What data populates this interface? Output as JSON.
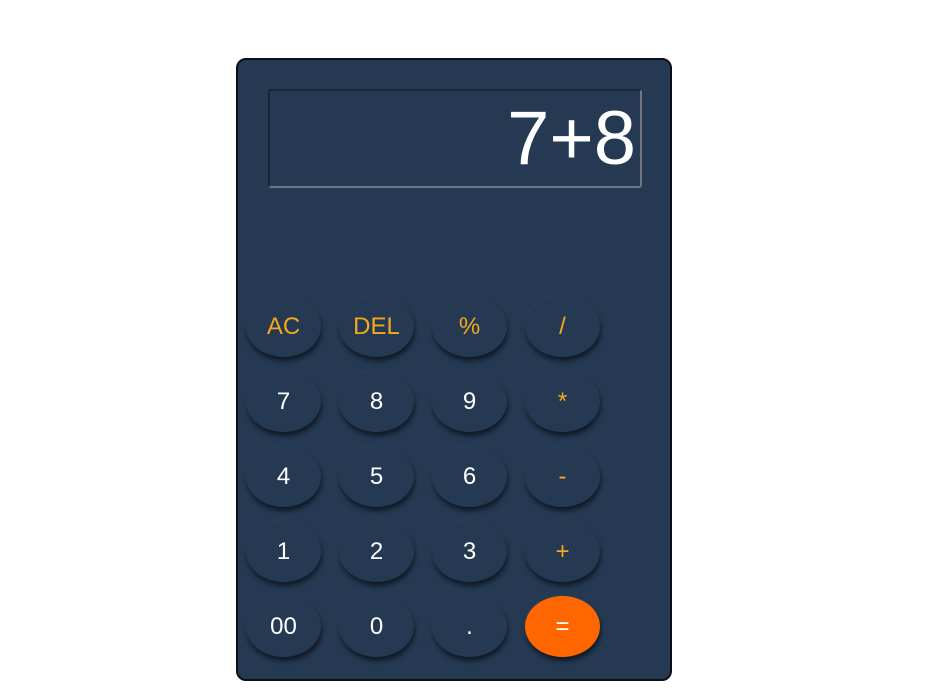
{
  "display": {
    "value": "7+8"
  },
  "colors": {
    "body": "#253953",
    "operator_text": "#f5a81b",
    "equals_bg": "#ff6600",
    "digit_text": "#ffffff"
  },
  "keys": [
    {
      "label": "AC",
      "kind": "op"
    },
    {
      "label": "DEL",
      "kind": "op"
    },
    {
      "label": "%",
      "kind": "op"
    },
    {
      "label": "/",
      "kind": "op"
    },
    {
      "label": "7",
      "kind": "digit"
    },
    {
      "label": "8",
      "kind": "digit"
    },
    {
      "label": "9",
      "kind": "digit"
    },
    {
      "label": "*",
      "kind": "op"
    },
    {
      "label": "4",
      "kind": "digit"
    },
    {
      "label": "5",
      "kind": "digit"
    },
    {
      "label": "6",
      "kind": "digit"
    },
    {
      "label": "-",
      "kind": "op"
    },
    {
      "label": "1",
      "kind": "digit"
    },
    {
      "label": "2",
      "kind": "digit"
    },
    {
      "label": "3",
      "kind": "digit"
    },
    {
      "label": "+",
      "kind": "op"
    },
    {
      "label": "00",
      "kind": "digit"
    },
    {
      "label": "0",
      "kind": "digit"
    },
    {
      "label": ".",
      "kind": "digit"
    },
    {
      "label": "=",
      "kind": "equals"
    }
  ]
}
